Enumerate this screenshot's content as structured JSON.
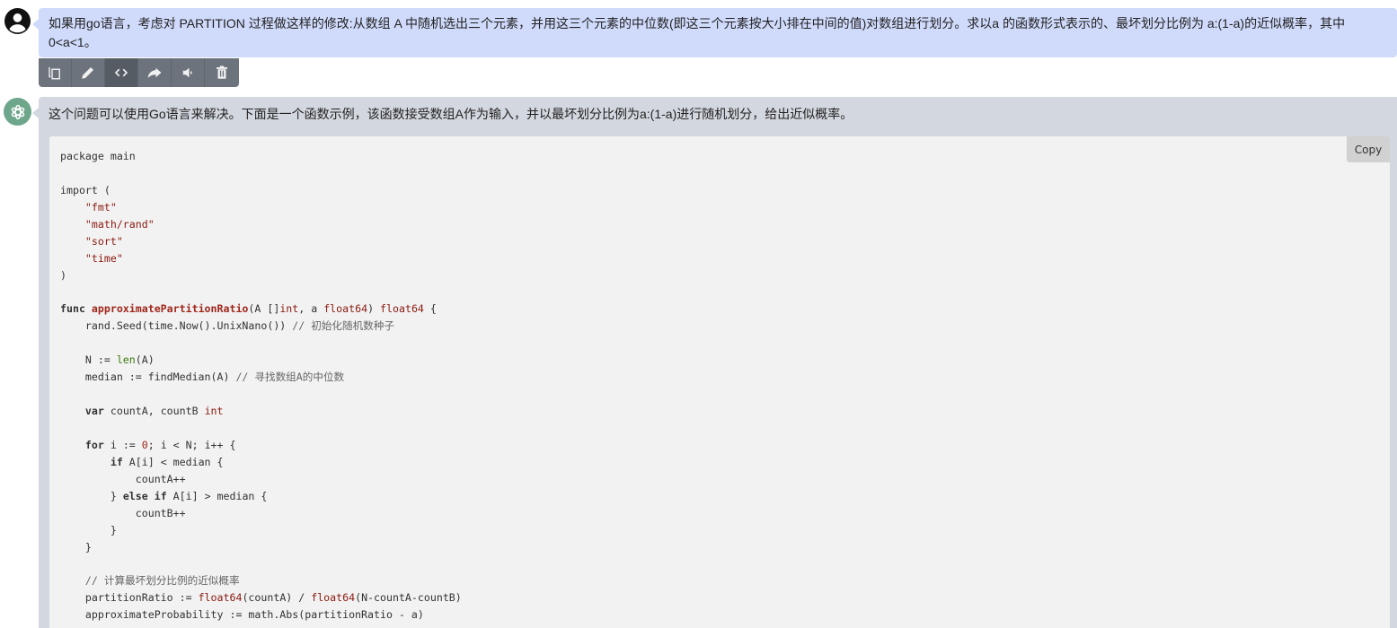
{
  "user_message": {
    "text": "如果用go语言，考虑对 PARTITION 过程做这样的修改:从数组 A 中随机选出三个元素，并用这三个元素的中位数(即这三个元素按大小排在中间的值)对数组进行划分。求以a 的函数形式表示的、最坏划分比例为 a:(1-a)的近似概率，其中0<a<1。"
  },
  "toolbar": {
    "buttons": [
      {
        "name": "copy",
        "icon": "copy-icon",
        "active": false
      },
      {
        "name": "edit",
        "icon": "pencil-icon",
        "active": false
      },
      {
        "name": "code",
        "icon": "code-icon",
        "active": true
      },
      {
        "name": "share",
        "icon": "share-icon",
        "active": false
      },
      {
        "name": "speak",
        "icon": "speaker-icon",
        "active": false
      },
      {
        "name": "delete",
        "icon": "trash-icon",
        "active": false
      }
    ]
  },
  "assistant_message": {
    "intro": "这个问题可以使用Go语言来解决。下面是一个函数示例，该函数接受数组A作为输入，并以最坏划分比例为a:(1-a)进行随机划分，给出近似概率。",
    "copy_label": "Copy",
    "code_lines": [
      [
        [
          "t",
          "package main"
        ]
      ],
      [],
      [
        [
          "t",
          "import ("
        ]
      ],
      [
        [
          "t",
          "    "
        ],
        [
          "str",
          "\"fmt\""
        ]
      ],
      [
        [
          "t",
          "    "
        ],
        [
          "str",
          "\"math/rand\""
        ]
      ],
      [
        [
          "t",
          "    "
        ],
        [
          "str",
          "\"sort\""
        ]
      ],
      [
        [
          "t",
          "    "
        ],
        [
          "str",
          "\"time\""
        ]
      ],
      [
        [
          "t",
          ")"
        ]
      ],
      [],
      [
        [
          "kw",
          "func "
        ],
        [
          "fn",
          "approximatePartitionRatio"
        ],
        [
          "t",
          "(A []"
        ],
        [
          "ty",
          "int"
        ],
        [
          "t",
          ", a "
        ],
        [
          "ty",
          "float64"
        ],
        [
          "t",
          ") "
        ],
        [
          "ty",
          "float64"
        ],
        [
          "t",
          " {"
        ]
      ],
      [
        [
          "t",
          "    rand.Seed(time.Now().UnixNano()) "
        ],
        [
          "cm",
          "// 初始化随机数种子"
        ]
      ],
      [],
      [
        [
          "t",
          "    N := "
        ],
        [
          "bi",
          "len"
        ],
        [
          "t",
          "(A)"
        ]
      ],
      [
        [
          "t",
          "    median := findMedian(A) "
        ],
        [
          "cm",
          "// 寻找数组A的中位数"
        ]
      ],
      [],
      [
        [
          "t",
          "    "
        ],
        [
          "kw",
          "var"
        ],
        [
          "t",
          " countA, countB "
        ],
        [
          "ty",
          "int"
        ]
      ],
      [],
      [
        [
          "t",
          "    "
        ],
        [
          "kw",
          "for"
        ],
        [
          "t",
          " i := "
        ],
        [
          "num",
          "0"
        ],
        [
          "t",
          "; i < N; i++ {"
        ]
      ],
      [
        [
          "t",
          "        "
        ],
        [
          "kw",
          "if"
        ],
        [
          "t",
          " A[i] < median {"
        ]
      ],
      [
        [
          "t",
          "            countA++"
        ]
      ],
      [
        [
          "t",
          "        } "
        ],
        [
          "kw",
          "else if"
        ],
        [
          "t",
          " A[i] > median {"
        ]
      ],
      [
        [
          "t",
          "            countB++"
        ]
      ],
      [
        [
          "t",
          "        }"
        ]
      ],
      [
        [
          "t",
          "    }"
        ]
      ],
      [],
      [
        [
          "t",
          "    "
        ],
        [
          "cm",
          "// 计算最坏划分比例的近似概率"
        ]
      ],
      [
        [
          "t",
          "    partitionRatio := "
        ],
        [
          "ty",
          "float64"
        ],
        [
          "t",
          "(countA) / "
        ],
        [
          "ty",
          "float64"
        ],
        [
          "t",
          "(N-countA-countB)"
        ]
      ],
      [
        [
          "t",
          "    approximateProbability := math.Abs(partitionRatio - a)"
        ]
      ]
    ]
  }
}
